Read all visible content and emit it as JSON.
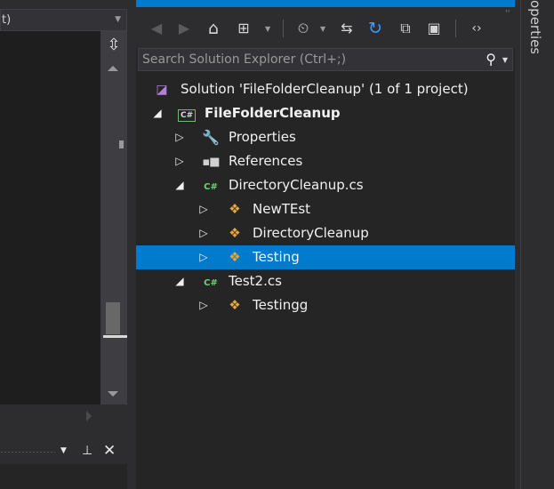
{
  "left": {
    "dropdown_text": "t)",
    "split_icon": "split-icon",
    "bottom_pin": "pin-icon",
    "bottom_close": "close-icon"
  },
  "solution_explorer": {
    "search_placeholder": "Search Solution Explorer (Ctrl+;)",
    "toolbar_icons": [
      "back-icon",
      "forward-icon",
      "home-icon",
      "sync-icon",
      "pending-changes-icon",
      "refresh-icon",
      "collapse-all-icon",
      "show-all-files-icon",
      "view-code-icon"
    ],
    "tree": [
      {
        "label": "Solution 'FileFolderCleanup' (1 of 1 project)",
        "icon": "solution-icon",
        "level": 0,
        "expander": "",
        "bold": false,
        "selected": false
      },
      {
        "label": "FileFolderCleanup",
        "icon": "csharp-project-icon",
        "level": 0,
        "expander": "expanded",
        "bold": true,
        "selected": false
      },
      {
        "label": "Properties",
        "icon": "wrench-icon",
        "level": 1,
        "expander": "collapsed",
        "bold": false,
        "selected": false
      },
      {
        "label": "References",
        "icon": "references-icon",
        "level": 1,
        "expander": "collapsed",
        "bold": false,
        "selected": false
      },
      {
        "label": "DirectoryCleanup.cs",
        "icon": "csharp-file-icon",
        "level": 1,
        "expander": "expanded",
        "bold": false,
        "selected": false
      },
      {
        "label": "NewTEst",
        "icon": "class-icon",
        "level": 2,
        "expander": "collapsed",
        "bold": false,
        "selected": false
      },
      {
        "label": "DirectoryCleanup",
        "icon": "class-icon",
        "level": 2,
        "expander": "collapsed",
        "bold": false,
        "selected": false
      },
      {
        "label": "Testing",
        "icon": "class-icon",
        "level": 2,
        "expander": "collapsed",
        "bold": false,
        "selected": true
      },
      {
        "label": "Test2.cs",
        "icon": "csharp-file-icon",
        "level": 1,
        "expander": "expanded",
        "bold": false,
        "selected": false
      },
      {
        "label": "Testingg",
        "icon": "class-icon",
        "level": 2,
        "expander": "collapsed",
        "bold": false,
        "selected": false
      }
    ]
  },
  "sidebar": {
    "properties_tab": "operties"
  },
  "colors": {
    "accent": "#007acc",
    "background": "#252526",
    "class_icon": "#e8a53b",
    "csharp_icon": "#6fd26f"
  }
}
